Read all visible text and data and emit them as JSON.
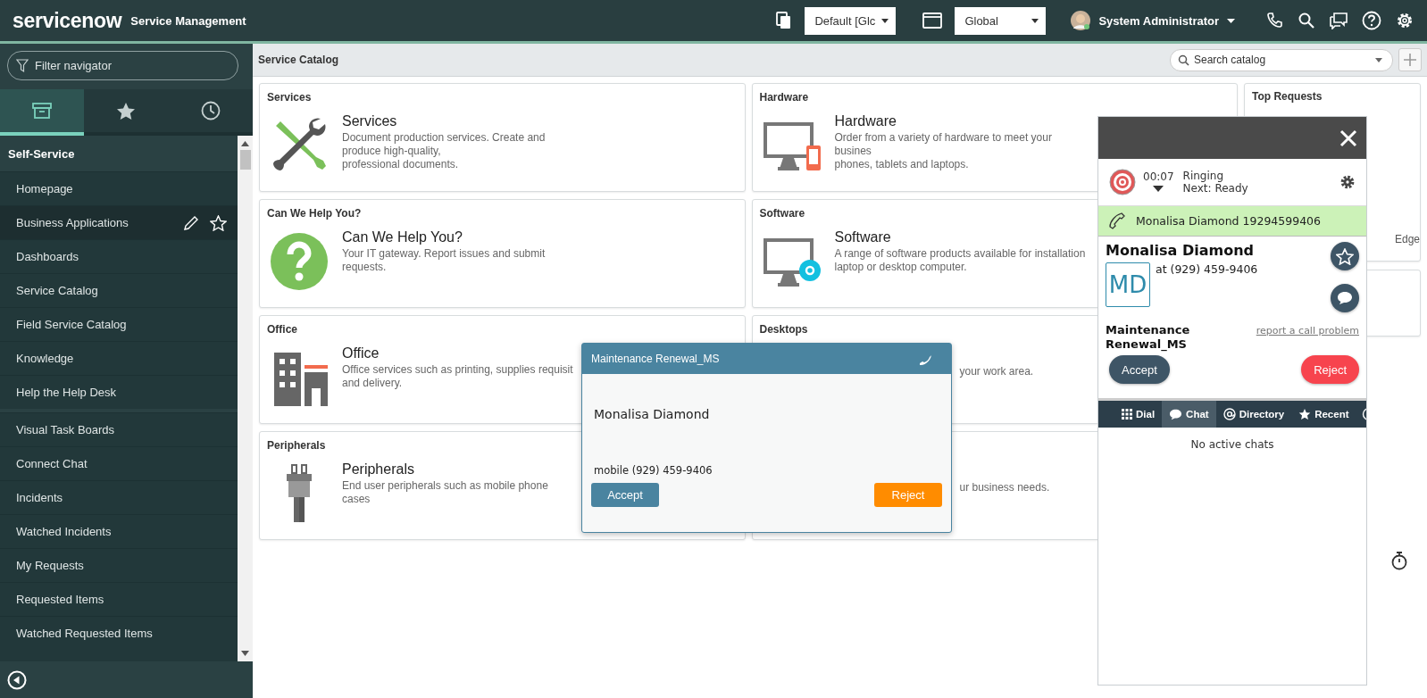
{
  "header": {
    "logo": "servicenow",
    "product": "Service Management",
    "update_set": "Default [Glc",
    "scope": "Global",
    "user": "System Administrator"
  },
  "navigator": {
    "filter": {
      "placeholder": "Filter navigator"
    },
    "tabs": [
      {
        "kind": "archive",
        "selected": true
      },
      {
        "kind": "star",
        "selected": false
      },
      {
        "kind": "history",
        "selected": false
      }
    ],
    "application": "Self-Service",
    "groups": [
      [
        {
          "label": "Homepage",
          "selected": false
        },
        {
          "label": "Business Applications",
          "selected": true
        },
        {
          "label": "Dashboards",
          "selected": false
        },
        {
          "label": "Service Catalog",
          "selected": false
        },
        {
          "label": "Field Service Catalog",
          "selected": false
        },
        {
          "label": "Knowledge",
          "selected": false
        },
        {
          "label": "Help the Help Desk",
          "selected": false
        }
      ],
      [
        {
          "label": "Visual Task Boards",
          "selected": false
        },
        {
          "label": "Connect Chat",
          "selected": false
        },
        {
          "label": "Incidents",
          "selected": false
        },
        {
          "label": "Watched Incidents",
          "selected": false
        },
        {
          "label": "My Requests",
          "selected": false
        },
        {
          "label": "Requested Items",
          "selected": false
        },
        {
          "label": "Watched Requested Items",
          "selected": false
        }
      ]
    ]
  },
  "catalog": {
    "title": "Service Catalog",
    "search": {
      "placeholder": "Search catalog"
    },
    "cards": [
      {
        "title": "Services",
        "kind": "tools",
        "name": "Services",
        "description_lines": [
          "Document production services. Create and produce high-quality,",
          "professional documents."
        ]
      },
      {
        "title": "Hardware",
        "kind": "monitor-phone",
        "name": "Hardware",
        "description_lines": [
          "Order from a variety of hardware to meet your busines",
          "phones, tablets and laptops."
        ]
      },
      {
        "title": "Can We Help You?",
        "kind": "question",
        "name": "Can We Help You?",
        "description_lines": [
          "Your IT gateway. Report issues and submit requests."
        ]
      },
      {
        "title": "Software",
        "kind": "monitor-disc",
        "name": "Software",
        "description_lines": [
          "A range of software products available for installation",
          "laptop or desktop computer."
        ]
      },
      {
        "title": "Office",
        "kind": "building",
        "name": "Office",
        "description_lines": [
          "Office services such as printing, supplies requisit",
          "and delivery."
        ]
      },
      {
        "title": "Desktops",
        "description_lines": [
          "your work area."
        ]
      },
      {
        "title": "Peripherals",
        "kind": "plug",
        "name": "Peripherals",
        "description_lines": [
          "End user peripherals such as mobile phone cases"
        ]
      },
      {
        "description_lines": [
          "ur business needs."
        ]
      }
    ],
    "top_requests": {
      "title": "Top Requests",
      "text": "Edge"
    }
  },
  "call_dialog": {
    "title": "Maintenance Renewal_MS",
    "caller": "Monalisa Diamond",
    "number": "mobile (929) 459-9406",
    "accept": "Accept",
    "reject": "Reject"
  },
  "phone_panel": {
    "timer": "00:07",
    "status": "Ringing",
    "next": "Next: Ready",
    "incoming": "Monalisa Diamond 19294599406",
    "contact": "Monalisa Diamond",
    "initials": "MD",
    "number": "at (929) 459-9406",
    "queue": "Maintenance Renewal_MS",
    "report_link": "report a call problem",
    "accept": "Accept",
    "reject": "Reject",
    "tabs": [
      {
        "kind": "dial",
        "label": "Dial",
        "selected": false
      },
      {
        "kind": "chat",
        "label": "Chat",
        "selected": true
      },
      {
        "kind": "directory",
        "label": "Directory",
        "selected": false
      },
      {
        "kind": "recent",
        "label": "Recent",
        "selected": false
      }
    ],
    "empty_message": "No active chats"
  }
}
